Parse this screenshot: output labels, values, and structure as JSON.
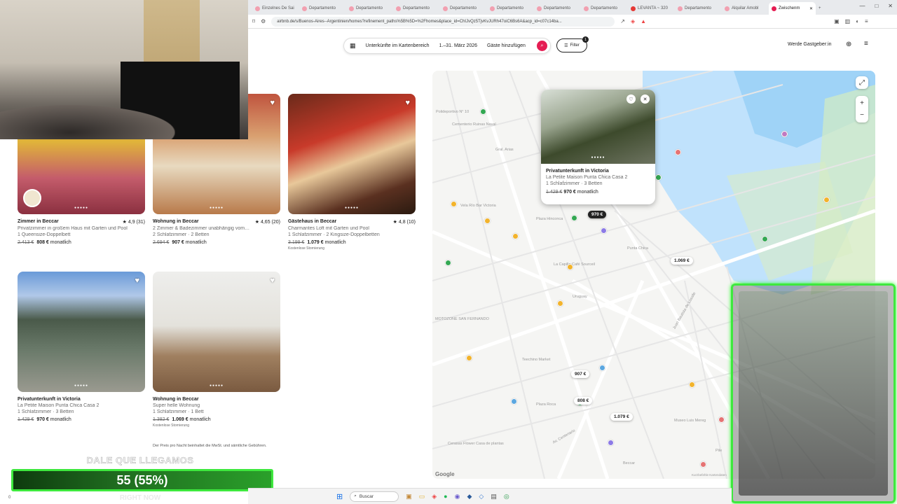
{
  "browser": {
    "tabs": [
      {
        "label": "Einzelnes De Sai"
      },
      {
        "label": "Departamento"
      },
      {
        "label": "Departamento"
      },
      {
        "label": "Departamento"
      },
      {
        "label": "Departamento"
      },
      {
        "label": "Departamento"
      },
      {
        "label": "Departamento"
      },
      {
        "label": "Departamento"
      },
      {
        "label": "LEVANTA ~ 320"
      },
      {
        "label": "Departamento"
      },
      {
        "label": "Alquilar Amobl"
      },
      {
        "label": "Zwischenm"
      }
    ],
    "url": "airbnb.de/s/Buenos-Aires--Argentinien/homes?refinement_paths%5B%5D=%2Fhomes&place_id=ChIJvQz5TjvKvJURh47oiC6Bs6A&acp_id=c07c14ba..."
  },
  "header": {
    "search_area": "Unterkünfte im Kartenbereich",
    "dates": "1.–31. März 2026",
    "guests": "Gäste hinzufügen",
    "filter_label": "Filter",
    "filter_count": "1",
    "host_link": "Werde Gastgeber:in"
  },
  "listings": [
    {
      "type": "Zimmer in Beccar",
      "rating": "★ 4,9 (31)",
      "desc": "Privatzimmer in großem Haus mit Garten und Pool",
      "beds": "1 Queensize-Doppelbett",
      "old_price": "2.413 €",
      "price": "808 €",
      "period": "monatlich",
      "note": ""
    },
    {
      "type": "Wohnung in Beccar",
      "rating": "★ 4,65 (20)",
      "desc": "2 Zimmer & Badezimmer unabhängig vom…",
      "beds": "2 Schlafzimmer · 2 Betten",
      "old_price": "2.694 €",
      "price": "907 €",
      "period": "monatlich",
      "note": ""
    },
    {
      "type": "Gästehaus in Beccar",
      "rating": "★ 4,8 (10)",
      "desc": "Charmantes Loft mit Garten und Pool",
      "beds": "1 Schlafzimmer · 2 Kingsize-Doppelbetten",
      "old_price": "3.199 €",
      "price": "1.079 €",
      "period": "monatlich",
      "note": "Kostenlose Stornierung"
    },
    {
      "type": "Privatunterkunft in Victoria",
      "rating": "",
      "desc": "La Petite Maison Punta Chica Casa 2",
      "beds": "1 Schlafzimmer · 3 Betten",
      "old_price": "1.429 €",
      "price": "970 €",
      "period": "monatlich",
      "note": ""
    },
    {
      "type": "Wohnung in Beccar",
      "rating": "",
      "desc": "Super helle Wohnung",
      "beds": "1 Schlafzimmer · 1 Bett",
      "old_price": "1.382 €",
      "price": "1.069 €",
      "period": "monatlich",
      "note": "Kostenlose Stornierung"
    }
  ],
  "footnote": "Der Preis pro Nacht beinhaltet die MwSt. und sämtliche Gebühren.",
  "map": {
    "popup": {
      "type": "Privatunterkunft in Victoria",
      "title": "La Petite Maison Punta Chica Casa 2",
      "beds": "1 Schlafzimmer · 3 Betten",
      "old_price": "1.429 €",
      "price": "970 €",
      "period": "monatlich"
    },
    "price_pins": {
      "selected": "970 €",
      "p1": "1.069 €",
      "p2": "907 €",
      "p3": "808 €",
      "p4": "1.079 €"
    },
    "labels": {
      "l1": "Polideportivo N° 10",
      "l2": "Cementerio Ruinas Naval",
      "l3": "Gral. Arias",
      "l4": "Vela Río Bar Victoria",
      "l5": "Plaza Hinconca",
      "l6": "Punta Chica",
      "l7": "La Capilla Café Sourceil",
      "l8": "MOTOZONE SAN FERNANDO",
      "l9": "Teechino Market",
      "l10": "Plaza Roca",
      "l11": "Uruguay",
      "l12": "Juan Bautista de Lasalle",
      "l13": "Museo Luis Mereg",
      "l14": "Beccar",
      "l15": "Av. Centenario",
      "l16": "Pile",
      "l17": "Cerasas Flower Casa de plantas",
      "l18": "Kurzbefehle Kartendaten"
    },
    "google": "Google"
  },
  "stream": {
    "goal_title": "DALE QUE LLEGAMOS",
    "goal_value": "55 (55%)",
    "goal_progress": 0.55,
    "goal_sub": "RIGHT NOW",
    "goal_max": "100",
    "goal_zero": "0"
  },
  "taskbar": {
    "search": "Buscar"
  },
  "colors": {
    "accent": "#e51d53",
    "overlay_green": "#3ee83e"
  }
}
